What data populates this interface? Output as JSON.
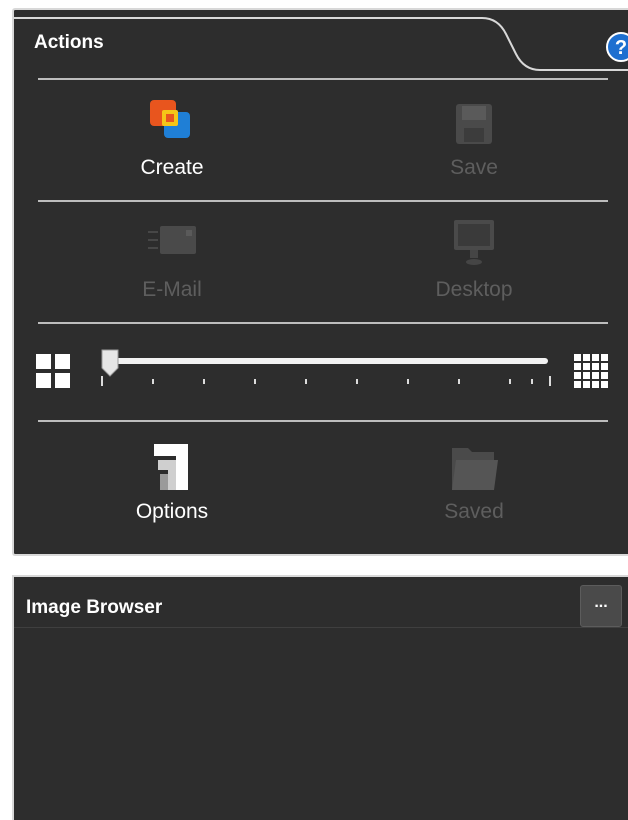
{
  "actions_panel": {
    "title": "Actions",
    "help_icon": "help-icon",
    "buttons": [
      {
        "label": "Create",
        "icon": "create-icon",
        "enabled": true
      },
      {
        "label": "Save",
        "icon": "save-icon",
        "enabled": false
      },
      {
        "label": "E-Mail",
        "icon": "email-icon",
        "enabled": false
      },
      {
        "label": "Desktop",
        "icon": "desktop-icon",
        "enabled": false
      },
      {
        "label": "Options",
        "icon": "options-icon",
        "enabled": true
      },
      {
        "label": "Saved",
        "icon": "saved-folder-icon",
        "enabled": false
      }
    ],
    "thumbnail_slider": {
      "min_icon": "grid-small-icon",
      "max_icon": "grid-large-icon",
      "value_fraction": 0.0,
      "tick_count": 10
    }
  },
  "image_browser": {
    "title": "Image Browser",
    "more_button_label": "..."
  },
  "colors": {
    "panel_bg": "#2d2d2d",
    "enabled_text": "#ffffff",
    "disabled_text": "#5e5e5e",
    "help_blue": "#1e6fd0"
  }
}
